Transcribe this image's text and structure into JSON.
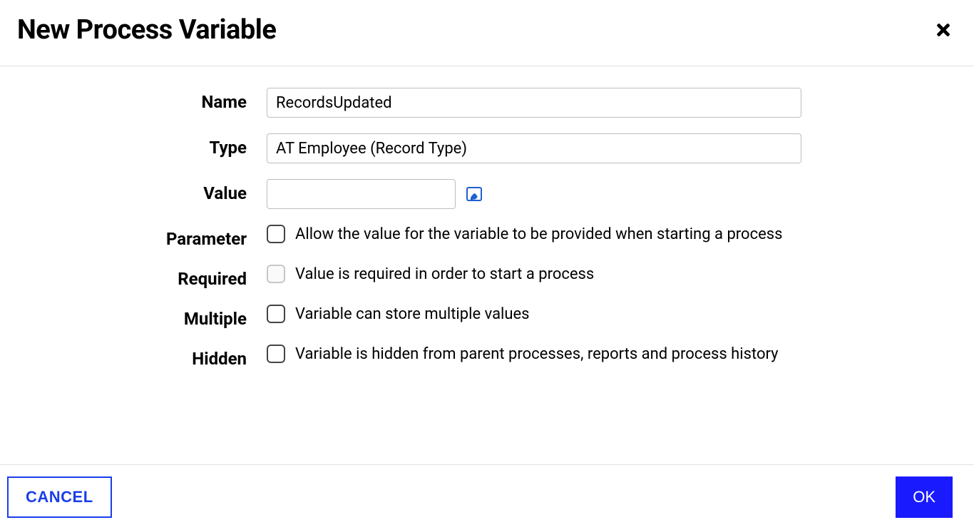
{
  "dialog": {
    "title": "New Process Variable"
  },
  "labels": {
    "name": "Name",
    "type": "Type",
    "value": "Value",
    "parameter": "Parameter",
    "required": "Required",
    "multiple": "Multiple",
    "hidden": "Hidden"
  },
  "fields": {
    "name_value": "RecordsUpdated",
    "type_value": "AT Employee (Record Type)",
    "value_value": ""
  },
  "descriptions": {
    "parameter": "Allow the value for the variable to be provided when starting a process",
    "required": "Value is required in order to start a process",
    "multiple": "Variable can store multiple values",
    "hidden": "Variable is hidden from parent processes, reports and process history"
  },
  "footer": {
    "cancel": "CANCEL",
    "ok": "OK"
  }
}
